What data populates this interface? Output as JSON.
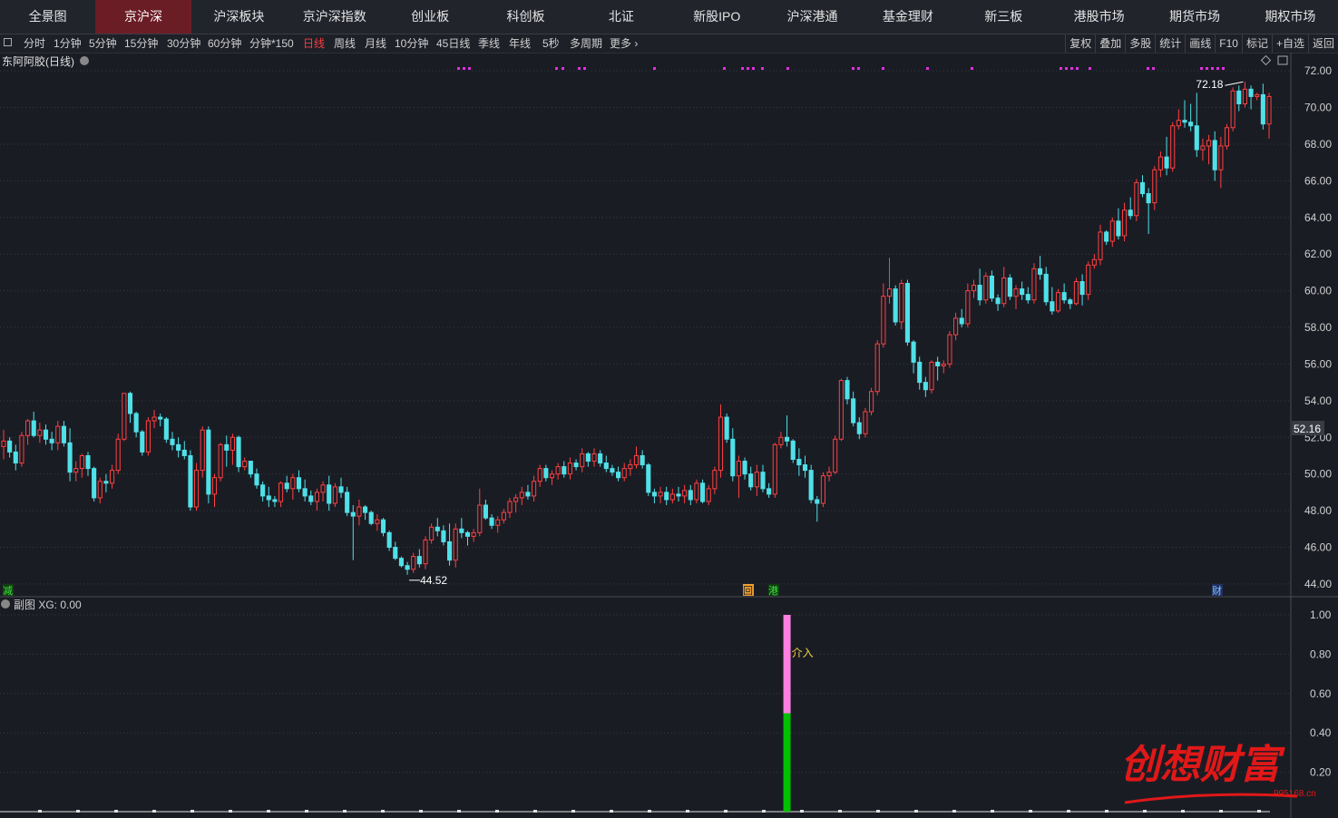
{
  "nav": {
    "tabs": [
      "全景图",
      "京沪深",
      "沪深板块",
      "京沪深指数",
      "创业板",
      "科创板",
      "北证",
      "新股IPO",
      "沪深港通",
      "基金理财",
      "新三板",
      "港股市场",
      "期货市场",
      "期权市场"
    ],
    "active_index": 1
  },
  "toolbar": {
    "periods": [
      "分时",
      "1分钟",
      "5分钟",
      "15分钟",
      "30分钟",
      "60分钟",
      "分钟*150",
      "日线",
      "周线",
      "月线",
      "10分钟",
      "45日线",
      "季线",
      "年线",
      "5秒",
      "多周期",
      "更多 ›"
    ],
    "active_period": "日线",
    "right_buttons": [
      "复权",
      "叠加",
      "多股",
      "统计",
      "画线",
      "F10",
      "标记",
      "+自选",
      "返回"
    ]
  },
  "stock_title": "东阿阿胶(日线)",
  "main_axis_labels": [
    "72.00",
    "70.00",
    "68.00",
    "66.00",
    "64.00",
    "62.00",
    "60.00",
    "58.00",
    "56.00",
    "54.00",
    "52.00",
    "50.00",
    "48.00",
    "46.00",
    "44.00"
  ],
  "current_price_label": "52.16",
  "high_label": "72.18",
  "low_label": "44.52",
  "event_markers": {
    "jian": "减",
    "hui": "回",
    "gang": "港",
    "cai": "财"
  },
  "sub_title": "副图  XG: 0.00",
  "sub_axis_labels": [
    "1.00",
    "0.80",
    "0.60",
    "0.40",
    "0.20"
  ],
  "signal_label": "介入",
  "watermark": {
    "text": "创想财富",
    "url": "995168.cn"
  },
  "colors": {
    "bg": "#1a1c24",
    "up": "#ff4040",
    "down": "#50e0e8",
    "grid": "#383a44",
    "signal_top": "#ff80e0",
    "signal_bottom": "#00c000"
  },
  "chart_data": {
    "type": "candlestick",
    "candles": [
      [
        51.5,
        52.4,
        50.8,
        51.8
      ],
      [
        51.8,
        52.0,
        50.9,
        51.2
      ],
      [
        51.2,
        51.6,
        50.2,
        50.6
      ],
      [
        50.6,
        52.3,
        50.4,
        52.1
      ],
      [
        52.1,
        53.0,
        51.6,
        52.9
      ],
      [
        52.9,
        53.4,
        52.0,
        52.1
      ],
      [
        52.1,
        52.8,
        51.7,
        52.4
      ],
      [
        52.4,
        52.7,
        51.6,
        51.9
      ],
      [
        51.9,
        52.3,
        51.3,
        51.7
      ],
      [
        51.7,
        52.9,
        51.3,
        52.6
      ],
      [
        52.6,
        52.9,
        51.5,
        51.7
      ],
      [
        51.7,
        52.5,
        49.6,
        50.1
      ],
      [
        50.1,
        50.7,
        49.6,
        50.3
      ],
      [
        50.3,
        51.1,
        49.8,
        51.0
      ],
      [
        51.0,
        51.2,
        49.9,
        50.3
      ],
      [
        50.3,
        50.4,
        48.5,
        48.7
      ],
      [
        48.7,
        49.8,
        48.4,
        49.6
      ],
      [
        49.6,
        50.0,
        49.0,
        49.5
      ],
      [
        49.5,
        50.5,
        49.2,
        50.2
      ],
      [
        50.2,
        52.2,
        50.0,
        51.9
      ],
      [
        51.9,
        54.4,
        51.8,
        54.4
      ],
      [
        54.4,
        54.5,
        52.8,
        53.3
      ],
      [
        53.3,
        53.4,
        52.0,
        52.3
      ],
      [
        52.3,
        52.4,
        51.0,
        51.2
      ],
      [
        51.2,
        53.1,
        51.0,
        52.9
      ],
      [
        52.9,
        53.5,
        52.5,
        53.1
      ],
      [
        53.1,
        53.3,
        52.6,
        53.0
      ],
      [
        53.0,
        53.1,
        51.7,
        51.9
      ],
      [
        51.9,
        52.3,
        51.3,
        51.6
      ],
      [
        51.6,
        52.0,
        50.9,
        51.3
      ],
      [
        51.3,
        51.8,
        50.8,
        51.0
      ],
      [
        51.0,
        51.3,
        48.0,
        48.2
      ],
      [
        48.2,
        50.6,
        48.0,
        50.2
      ],
      [
        50.2,
        52.6,
        49.8,
        52.4
      ],
      [
        52.4,
        52.6,
        48.4,
        48.9
      ],
      [
        48.9,
        50.0,
        48.2,
        49.8
      ],
      [
        49.8,
        51.7,
        49.6,
        51.6
      ],
      [
        51.6,
        52.1,
        50.4,
        51.3
      ],
      [
        51.3,
        52.2,
        50.5,
        52.0
      ],
      [
        52.0,
        52.1,
        50.1,
        50.4
      ],
      [
        50.4,
        50.9,
        50.2,
        50.7
      ],
      [
        50.7,
        50.7,
        49.8,
        50.0
      ],
      [
        50.0,
        50.3,
        49.2,
        49.4
      ],
      [
        49.4,
        49.6,
        48.5,
        48.8
      ],
      [
        48.8,
        49.3,
        48.2,
        48.6
      ],
      [
        48.6,
        48.8,
        48.2,
        48.5
      ],
      [
        48.5,
        49.6,
        48.2,
        49.5
      ],
      [
        49.5,
        49.9,
        49.0,
        49.2
      ],
      [
        49.2,
        50.0,
        48.6,
        49.8
      ],
      [
        49.8,
        50.2,
        49.0,
        49.2
      ],
      [
        49.2,
        49.7,
        48.5,
        48.8
      ],
      [
        48.8,
        49.1,
        48.3,
        48.5
      ],
      [
        48.5,
        49.2,
        48.0,
        49.0
      ],
      [
        49.0,
        49.6,
        48.5,
        49.4
      ],
      [
        49.4,
        49.9,
        48.0,
        48.4
      ],
      [
        48.4,
        49.5,
        48.2,
        49.3
      ],
      [
        49.3,
        49.8,
        48.7,
        49.0
      ],
      [
        49.0,
        49.3,
        47.7,
        47.9
      ],
      [
        47.9,
        48.3,
        45.3,
        47.7
      ],
      [
        47.7,
        48.6,
        47.2,
        48.2
      ],
      [
        48.2,
        48.3,
        47.5,
        47.9
      ],
      [
        47.9,
        48.0,
        47.2,
        47.3
      ],
      [
        47.3,
        47.8,
        46.9,
        47.5
      ],
      [
        47.5,
        47.6,
        46.6,
        46.8
      ],
      [
        46.8,
        46.9,
        45.8,
        46.0
      ],
      [
        46.0,
        46.3,
        45.3,
        45.4
      ],
      [
        45.4,
        45.5,
        44.9,
        45.0
      ],
      [
        45.0,
        45.2,
        44.5,
        44.8
      ],
      [
        44.8,
        45.7,
        44.6,
        45.5
      ],
      [
        45.5,
        45.9,
        44.9,
        45.1
      ],
      [
        45.1,
        46.6,
        44.8,
        46.4
      ],
      [
        46.4,
        47.3,
        46.2,
        47.1
      ],
      [
        47.1,
        47.6,
        46.6,
        46.9
      ],
      [
        46.9,
        47.2,
        46.1,
        46.3
      ],
      [
        46.3,
        47.3,
        45.0,
        45.3
      ],
      [
        45.3,
        47.3,
        44.9,
        47.0
      ],
      [
        47.0,
        47.6,
        46.5,
        46.8
      ],
      [
        46.8,
        46.9,
        46.1,
        46.6
      ],
      [
        46.6,
        47.0,
        46.3,
        46.8
      ],
      [
        46.8,
        49.2,
        46.6,
        48.3
      ],
      [
        48.3,
        48.6,
        47.5,
        47.6
      ],
      [
        47.6,
        47.8,
        47.0,
        47.2
      ],
      [
        47.2,
        47.7,
        46.8,
        47.5
      ],
      [
        47.5,
        48.1,
        47.3,
        47.9
      ],
      [
        47.9,
        48.7,
        47.6,
        48.5
      ],
      [
        48.5,
        48.9,
        47.9,
        48.7
      ],
      [
        48.7,
        49.3,
        48.3,
        49.0
      ],
      [
        49.0,
        49.4,
        48.6,
        48.8
      ],
      [
        48.8,
        49.9,
        48.5,
        49.6
      ],
      [
        49.6,
        50.5,
        49.3,
        50.3
      ],
      [
        50.3,
        50.5,
        49.6,
        49.8
      ],
      [
        49.8,
        50.2,
        49.4,
        50.0
      ],
      [
        50.0,
        50.6,
        49.7,
        50.4
      ],
      [
        50.4,
        50.7,
        49.8,
        50.0
      ],
      [
        50.0,
        50.9,
        49.7,
        50.6
      ],
      [
        50.6,
        50.8,
        50.2,
        50.4
      ],
      [
        50.4,
        51.4,
        50.1,
        51.1
      ],
      [
        51.1,
        51.2,
        50.4,
        50.7
      ],
      [
        50.7,
        51.4,
        50.4,
        51.1
      ],
      [
        51.1,
        51.3,
        50.4,
        50.6
      ],
      [
        50.6,
        51.0,
        50.1,
        50.3
      ],
      [
        50.3,
        50.5,
        49.9,
        50.1
      ],
      [
        50.1,
        50.4,
        49.6,
        49.8
      ],
      [
        49.8,
        50.6,
        49.6,
        50.3
      ],
      [
        50.3,
        50.8,
        49.9,
        50.5
      ],
      [
        50.5,
        51.5,
        50.3,
        51.0
      ],
      [
        51.0,
        51.3,
        50.3,
        50.5
      ],
      [
        50.5,
        50.6,
        48.8,
        49.0
      ],
      [
        49.0,
        49.2,
        48.4,
        48.8
      ],
      [
        48.8,
        49.3,
        48.4,
        49.0
      ],
      [
        49.0,
        49.3,
        48.3,
        48.6
      ],
      [
        48.6,
        49.2,
        48.4,
        48.9
      ],
      [
        48.9,
        49.3,
        48.5,
        48.8
      ],
      [
        48.8,
        49.4,
        48.4,
        49.1
      ],
      [
        49.1,
        49.4,
        48.3,
        48.6
      ],
      [
        48.6,
        49.7,
        48.4,
        49.5
      ],
      [
        49.5,
        49.7,
        48.4,
        48.5
      ],
      [
        48.5,
        49.4,
        48.3,
        49.2
      ],
      [
        49.2,
        50.4,
        48.9,
        50.2
      ],
      [
        50.2,
        53.8,
        49.8,
        53.1
      ],
      [
        53.1,
        53.3,
        51.7,
        51.9
      ],
      [
        51.9,
        52.5,
        49.6,
        49.9
      ],
      [
        49.9,
        51.0,
        48.7,
        50.7
      ],
      [
        50.7,
        50.9,
        49.7,
        50.0
      ],
      [
        50.0,
        50.4,
        49.1,
        49.3
      ],
      [
        49.3,
        50.5,
        48.8,
        50.1
      ],
      [
        50.1,
        50.5,
        49.0,
        49.2
      ],
      [
        49.2,
        49.5,
        48.7,
        48.9
      ],
      [
        48.9,
        51.7,
        48.7,
        51.6
      ],
      [
        51.6,
        52.3,
        51.4,
        52.0
      ],
      [
        52.0,
        53.2,
        51.5,
        51.8
      ],
      [
        51.8,
        51.9,
        50.6,
        50.8
      ],
      [
        50.8,
        51.4,
        49.9,
        50.5
      ],
      [
        50.5,
        51.0,
        49.8,
        50.2
      ],
      [
        50.2,
        50.5,
        48.4,
        48.6
      ],
      [
        48.6,
        48.8,
        47.4,
        48.4
      ],
      [
        48.4,
        50.1,
        48.2,
        49.9
      ],
      [
        49.9,
        50.4,
        49.6,
        50.1
      ],
      [
        50.1,
        52.1,
        50.0,
        51.9
      ],
      [
        51.9,
        55.2,
        51.8,
        55.1
      ],
      [
        55.1,
        55.3,
        53.8,
        54.1
      ],
      [
        54.1,
        54.5,
        52.6,
        52.8
      ],
      [
        52.8,
        53.1,
        51.9,
        52.2
      ],
      [
        52.2,
        53.6,
        52.0,
        53.4
      ],
      [
        53.4,
        54.7,
        53.2,
        54.5
      ],
      [
        54.5,
        57.3,
        54.3,
        57.1
      ],
      [
        57.1,
        60.4,
        56.9,
        59.7
      ],
      [
        59.7,
        61.8,
        59.3,
        60.1
      ],
      [
        60.1,
        60.3,
        58.1,
        58.3
      ],
      [
        58.3,
        60.6,
        57.9,
        60.4
      ],
      [
        60.4,
        60.6,
        57.0,
        57.2
      ],
      [
        57.2,
        57.3,
        55.5,
        56.1
      ],
      [
        56.1,
        56.4,
        54.6,
        55.0
      ],
      [
        55.0,
        55.3,
        54.2,
        54.6
      ],
      [
        54.6,
        56.2,
        54.4,
        56.1
      ],
      [
        56.1,
        56.4,
        55.1,
        55.9
      ],
      [
        55.9,
        56.2,
        55.5,
        56.0
      ],
      [
        56.0,
        57.8,
        55.8,
        57.6
      ],
      [
        57.6,
        58.8,
        57.3,
        58.5
      ],
      [
        58.5,
        59.0,
        58.0,
        58.2
      ],
      [
        58.2,
        60.4,
        58.0,
        60.0
      ],
      [
        60.0,
        60.6,
        59.6,
        60.3
      ],
      [
        60.3,
        61.2,
        59.2,
        59.5
      ],
      [
        59.5,
        61.0,
        59.3,
        60.8
      ],
      [
        60.8,
        61.1,
        59.4,
        59.6
      ],
      [
        59.6,
        59.8,
        58.9,
        59.3
      ],
      [
        59.3,
        61.3,
        59.1,
        60.7
      ],
      [
        60.7,
        60.9,
        59.5,
        59.7
      ],
      [
        59.7,
        60.3,
        59.0,
        60.1
      ],
      [
        60.1,
        60.5,
        59.5,
        59.8
      ],
      [
        59.8,
        60.2,
        59.3,
        59.5
      ],
      [
        59.5,
        61.5,
        59.3,
        61.2
      ],
      [
        61.2,
        61.9,
        60.6,
        60.9
      ],
      [
        60.9,
        61.3,
        59.2,
        59.4
      ],
      [
        59.4,
        60.2,
        58.7,
        58.9
      ],
      [
        58.9,
        60.1,
        58.8,
        59.9
      ],
      [
        59.9,
        60.4,
        59.3,
        59.5
      ],
      [
        59.5,
        59.6,
        59.0,
        59.3
      ],
      [
        59.3,
        60.7,
        59.2,
        60.5
      ],
      [
        60.5,
        60.9,
        59.2,
        59.8
      ],
      [
        59.8,
        61.6,
        59.5,
        61.4
      ],
      [
        61.4,
        62.0,
        61.2,
        61.7
      ],
      [
        61.7,
        63.6,
        61.4,
        63.2
      ],
      [
        63.2,
        63.3,
        62.5,
        62.7
      ],
      [
        62.7,
        64.0,
        62.4,
        63.8
      ],
      [
        63.8,
        64.5,
        62.8,
        63.0
      ],
      [
        63.0,
        64.8,
        62.7,
        64.4
      ],
      [
        64.4,
        65.1,
        63.9,
        64.1
      ],
      [
        64.1,
        66.1,
        63.8,
        65.9
      ],
      [
        65.9,
        66.3,
        65.1,
        65.3
      ],
      [
        65.3,
        65.6,
        63.1,
        64.8
      ],
      [
        64.8,
        66.8,
        64.4,
        66.6
      ],
      [
        66.6,
        67.6,
        66.2,
        67.3
      ],
      [
        67.3,
        68.4,
        66.3,
        66.7
      ],
      [
        66.7,
        69.2,
        66.5,
        69.0
      ],
      [
        69.0,
        69.9,
        68.8,
        69.3
      ],
      [
        69.3,
        70.4,
        68.9,
        69.2
      ],
      [
        69.2,
        70.2,
        68.7,
        69.0
      ],
      [
        69.0,
        70.8,
        67.3,
        67.7
      ],
      [
        67.7,
        68.3,
        67.1,
        67.9
      ],
      [
        67.9,
        68.5,
        66.9,
        68.2
      ],
      [
        68.2,
        68.7,
        66.0,
        66.6
      ],
      [
        66.6,
        68.4,
        65.6,
        67.9
      ],
      [
        67.9,
        69.1,
        67.7,
        68.9
      ],
      [
        68.9,
        71.1,
        68.7,
        70.9
      ],
      [
        70.9,
        71.2,
        69.8,
        70.2
      ],
      [
        70.2,
        71.4,
        70.0,
        71.0
      ],
      [
        71.0,
        71.2,
        69.9,
        70.6
      ],
      [
        70.6,
        70.8,
        70.4,
        70.7
      ],
      [
        70.7,
        71.3,
        68.8,
        69.1
      ],
      [
        69.1,
        70.8,
        68.3,
        70.6
      ]
    ],
    "ylim": [
      43.6,
      72.6
    ],
    "y_ticks": [
      72,
      70,
      68,
      66,
      64,
      62,
      60,
      58,
      56,
      54,
      52,
      50,
      48,
      46,
      44
    ],
    "sub_signal": {
      "index": 130,
      "value": 1.0,
      "split": 0.5
    },
    "sub_ylim": [
      0,
      1.0
    ]
  }
}
